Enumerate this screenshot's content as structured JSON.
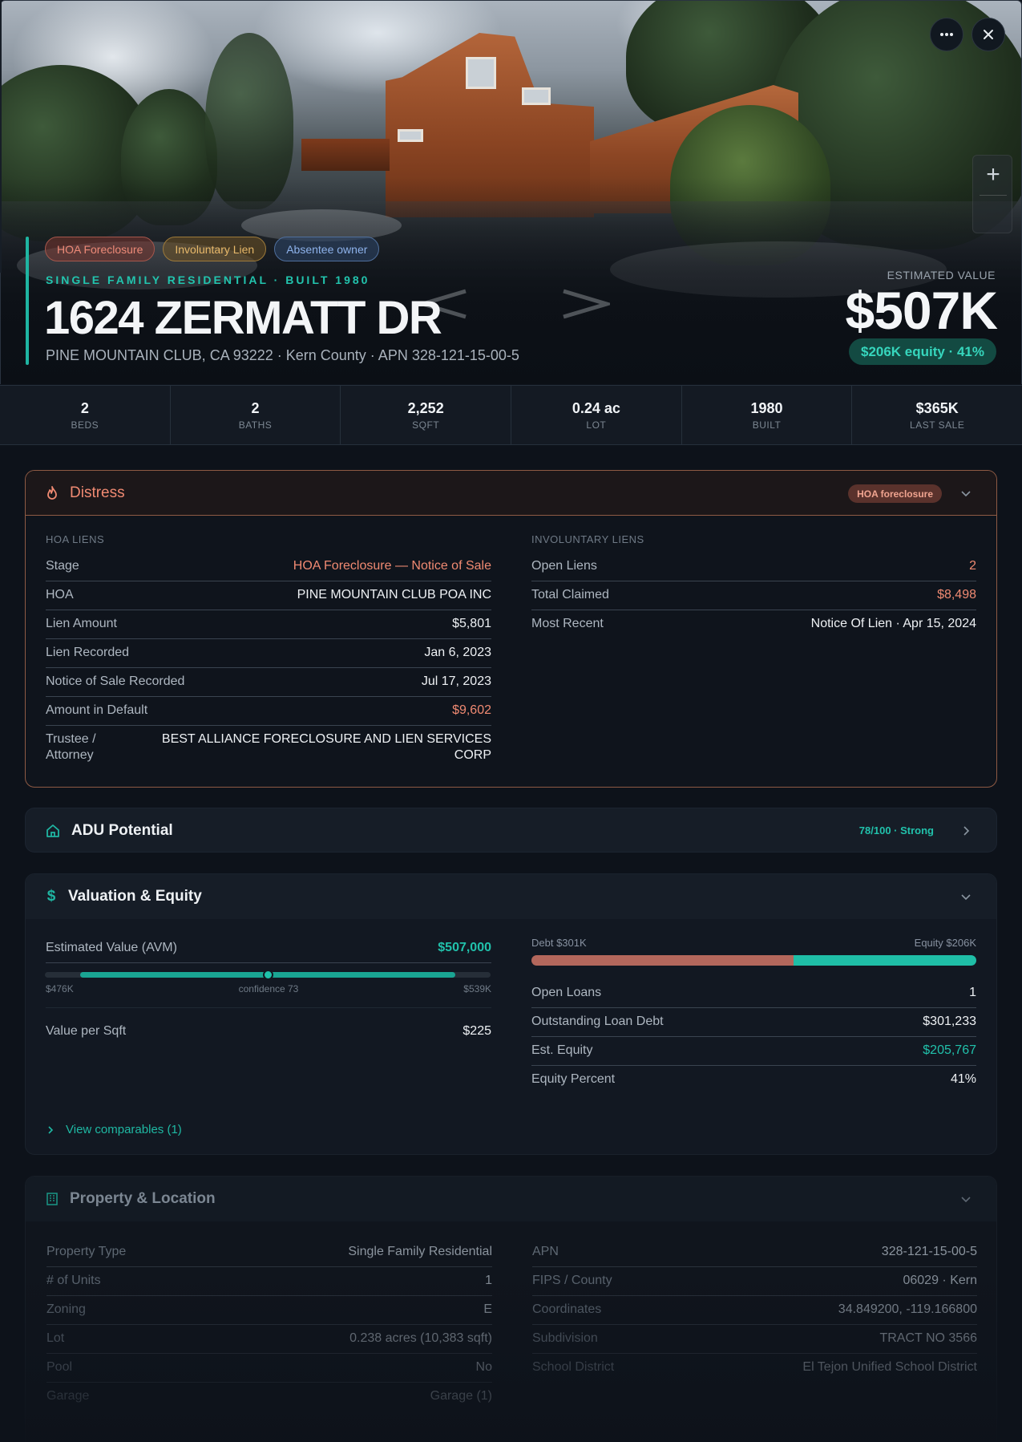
{
  "hero": {
    "chips": [
      "HOA Foreclosure",
      "Involuntary Lien",
      "Absentee owner"
    ],
    "eyebrow": "SINGLE FAMILY RESIDENTIAL · BUILT 1980",
    "address": "1624 ZERMATT DR",
    "subaddress": "PINE MOUNTAIN CLUB, CA 93222 · Kern County · APN 328-121-15-00-5",
    "estimated_label": "ESTIMATED VALUE",
    "estimated_value": "$507K",
    "equity_pill": "$206K equity · 41%",
    "zoom_in": "+",
    "icons": {
      "more": "more-horizontal-icon",
      "close": "close-icon"
    }
  },
  "stats": [
    {
      "value": "2",
      "label": "BEDS"
    },
    {
      "value": "2",
      "label": "BATHS"
    },
    {
      "value": "2,252",
      "label": "SQFT"
    },
    {
      "value": "0.24 ac",
      "label": "LOT"
    },
    {
      "value": "1980",
      "label": "BUILT"
    },
    {
      "value": "$365K",
      "label": "LAST SALE"
    }
  ],
  "distress": {
    "title": "Distress",
    "badge": "HOA foreclosure",
    "left_label": "HOA LIENS",
    "left_rows": [
      {
        "k": "Stage",
        "v": "HOA Foreclosure — Notice of Sale"
      },
      {
        "k": "HOA",
        "v": "PINE MOUNTAIN CLUB POA INC"
      },
      {
        "k": "Lien Amount",
        "v": "$5,801"
      },
      {
        "k": "Lien Recorded",
        "v": "Jan 6, 2023"
      },
      {
        "k": "Notice of Sale Recorded",
        "v": "Jul 17, 2023"
      },
      {
        "k": "Amount in Default",
        "v": "$9,602"
      }
    ],
    "trustee_k1": "Trustee /",
    "trustee_k2": "Attorney",
    "trustee_v1": "BEST ALLIANCE FORECLOSURE AND LIEN SERVICES",
    "trustee_v2": "CORP",
    "right_label": "INVOLUNTARY LIENS",
    "right_rows": [
      {
        "k": "Open Liens",
        "v": "2"
      },
      {
        "k": "Total Claimed",
        "v": "$8,498"
      },
      {
        "k": "Most Recent",
        "v": "Notice Of Lien · Apr 15, 2024"
      }
    ]
  },
  "adu": {
    "title": "ADU Potential",
    "score": "78/100 · Strong"
  },
  "valuation": {
    "title": "Valuation & Equity",
    "avm_label": "Estimated Value (AVM)",
    "avm_value": "$507,000",
    "range_low": "$476K",
    "range_high": "$539K",
    "confidence": "confidence 73",
    "range_fill_start": 0.08,
    "range_fill_end": 0.92,
    "range_marker": 0.5,
    "per_sqft_label": "Value per Sqft",
    "per_sqft_value": "$225",
    "debt_label": "Debt $301K",
    "equity_label": "Equity $206K",
    "debt_fraction": 0.59,
    "right_rows": [
      {
        "k": "Open Loans",
        "v": "1"
      },
      {
        "k": "Outstanding Loan Debt",
        "v": "$301,233"
      },
      {
        "k": "Est. Equity",
        "v": "$205,767"
      },
      {
        "k": "Equity Percent",
        "v": "41%"
      }
    ],
    "comparables": "View comparables (1)"
  },
  "property": {
    "title": "Property & Location",
    "left_rows": [
      {
        "k": "Property Type",
        "v": "Single Family Residential"
      },
      {
        "k": "# of Units",
        "v": "1"
      },
      {
        "k": "Zoning",
        "v": "E"
      },
      {
        "k": "Lot",
        "v": "0.238 acres (10,383 sqft)"
      },
      {
        "k": "Pool",
        "v": "No"
      },
      {
        "k": "Garage",
        "v": "Garage (1)"
      }
    ],
    "right_rows": [
      {
        "k": "APN",
        "v": "328-121-15-00-5"
      },
      {
        "k": "FIPS / County",
        "v": "06029 · Kern"
      },
      {
        "k": "Coordinates",
        "v": "34.849200, -119.166800"
      },
      {
        "k": "Subdivision",
        "v": "TRACT NO 3566"
      },
      {
        "k": "School District",
        "v": "El Tejon Unified School District"
      }
    ]
  },
  "colors": {
    "accent": "#1fb5a2",
    "alert": "#f08a72",
    "debt": "#b3675c"
  }
}
